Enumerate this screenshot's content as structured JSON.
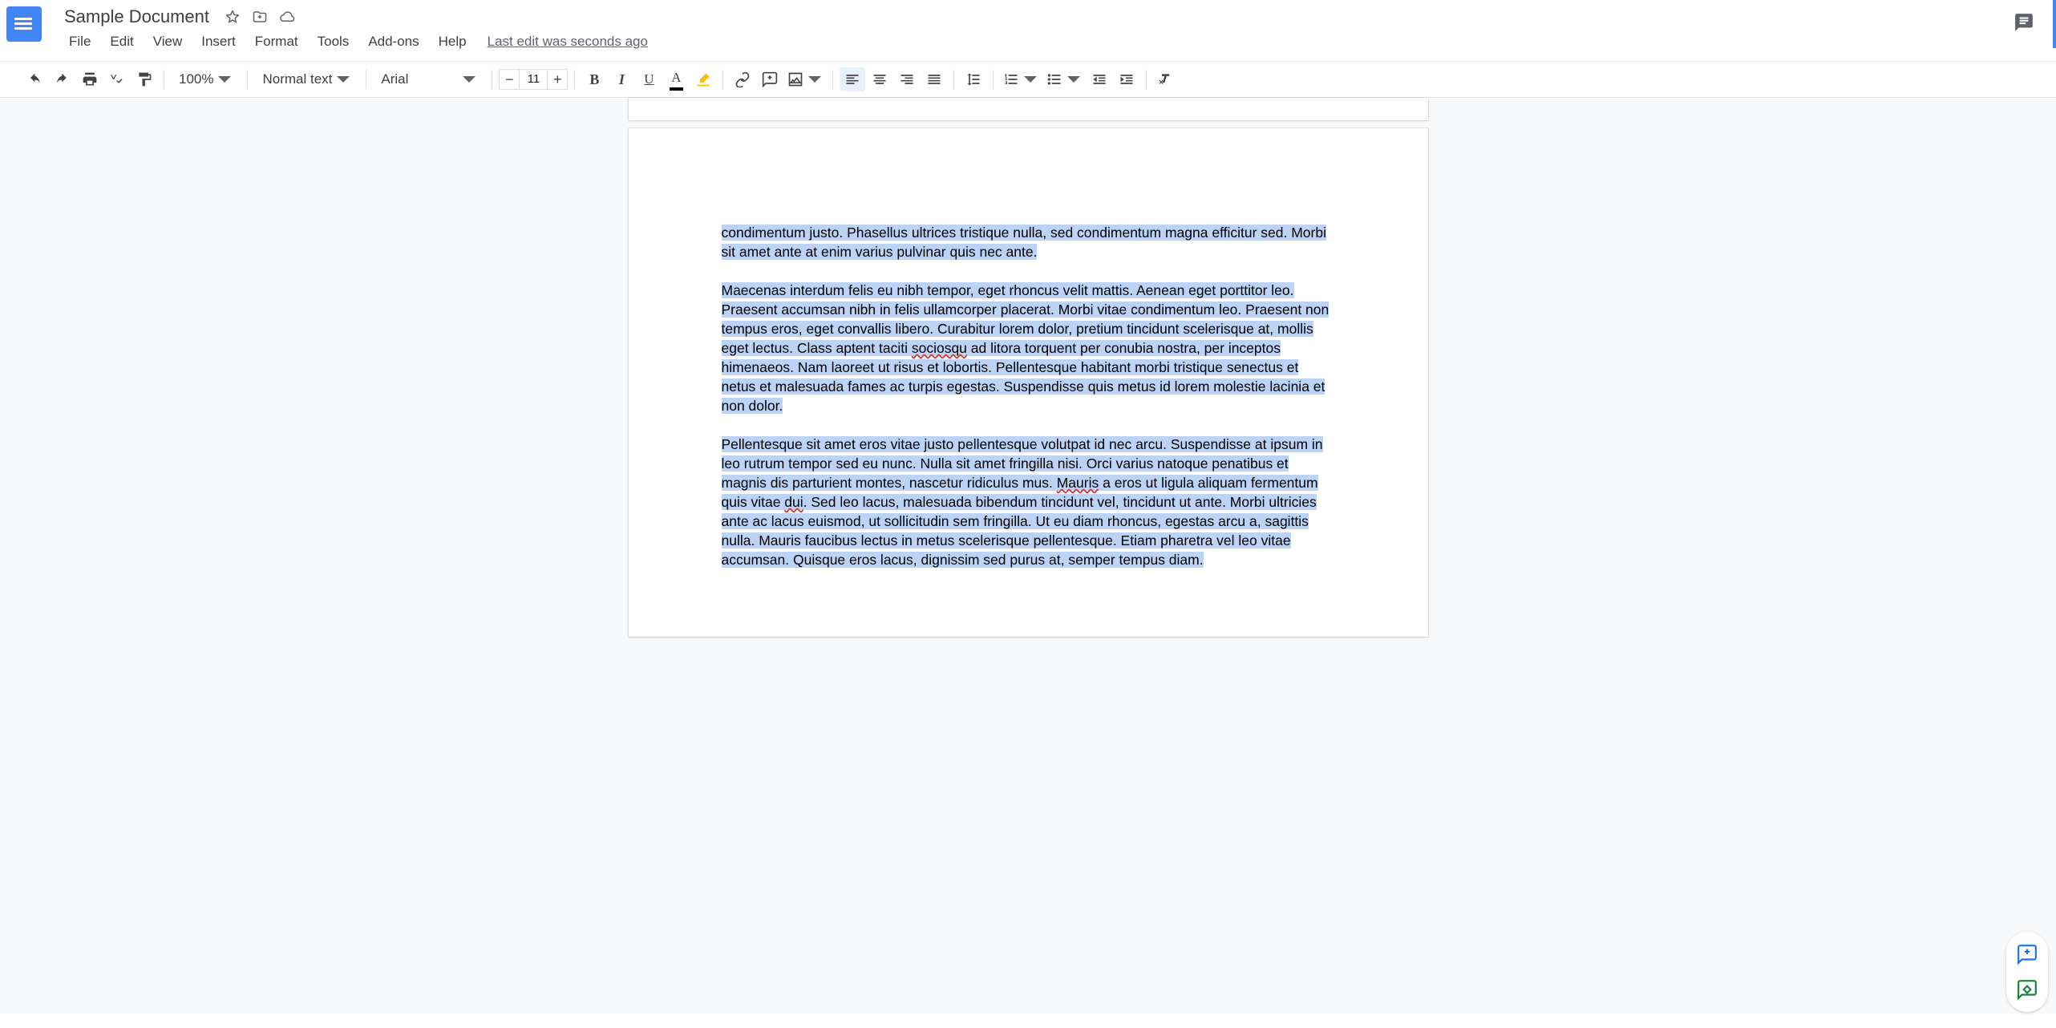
{
  "header": {
    "title": "Sample Document",
    "last_edit": "Last edit was seconds ago"
  },
  "menus": [
    "File",
    "Edit",
    "View",
    "Insert",
    "Format",
    "Tools",
    "Add-ons",
    "Help"
  ],
  "toolbar": {
    "zoom": "100%",
    "style": "Normal text",
    "font": "Arial",
    "font_size": "11"
  },
  "document": {
    "p1": "condimentum justo. Phasellus ultrices tristique nulla, sed condimentum magna efficitur sed. Morbi sit amet ante at enim varius pulvinar quis nec ante.",
    "p2a": "Maecenas interdum felis eu nibh tempor, eget rhoncus velit mattis. Aenean eget porttitor leo. Praesent accumsan nibh in felis ullamcorper placerat. Morbi vitae condimentum leo. Praesent non tempus eros, eget convallis libero. Curabitur lorem dolor, pretium tincidunt scelerisque at, mollis eget lectus. Class aptent taciti ",
    "p2_s1": "sociosqu",
    "p2b": " ad litora torquent per conubia nostra, per inceptos himenaeos. Nam laoreet ut risus et lobortis. Pellentesque habitant morbi tristique senectus et netus et malesuada fames ac turpis egestas. Suspendisse quis metus id lorem molestie lacinia et non dolor.",
    "p3a": "Pellentesque sit amet eros vitae justo pellentesque volutpat id nec arcu. Suspendisse at ipsum in leo rutrum tempor sed eu nunc. Nulla sit amet fringilla nisi. Orci varius natoque penatibus et magnis dis parturient montes, nascetur ridiculus mus. ",
    "p3_s1": "Mauris",
    "p3b": " a eros ut ligula aliquam fermentum quis vitae ",
    "p3_s2": "dui",
    "p3c": ". Sed leo lacus, malesuada bibendum tincidunt vel, tincidunt ut ante. Morbi ultricies ante ac lacus euismod, ut sollicitudin sem fringilla. Ut eu diam rhoncus, egestas arcu a, sagittis nulla. Mauris faucibus lectus in metus scelerisque pellentesque. Etiam pharetra vel leo vitae accumsan. Quisque eros lacus, dignissim sed purus at, semper tempus diam."
  }
}
